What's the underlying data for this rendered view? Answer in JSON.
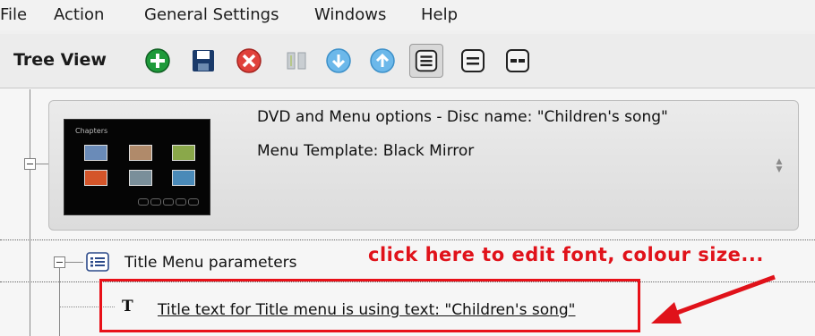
{
  "menubar": {
    "items": [
      "File",
      "Action",
      "General Settings",
      "Windows",
      "Help"
    ]
  },
  "toolbar": {
    "title": "Tree View",
    "buttons": [
      {
        "icon": "add-icon",
        "color": "#1e9a3a"
      },
      {
        "icon": "save-icon",
        "color": "#1a3a6a"
      },
      {
        "icon": "delete-icon",
        "color": "#e0413b"
      },
      {
        "icon": "split-icon",
        "color": "#9aa2a8"
      },
      {
        "icon": "move-down-icon",
        "color": "#4aa3e0"
      },
      {
        "icon": "move-up-icon",
        "color": "#4aa3e0"
      },
      {
        "icon": "view-list-icon",
        "selected": true
      },
      {
        "icon": "view-compact-icon"
      },
      {
        "icon": "view-detail-icon"
      }
    ]
  },
  "dvd": {
    "line1": "DVD and Menu options - Disc name: \"Children's song\"",
    "line2": "Menu Template: Black Mirror",
    "thumb_label": "Chapters"
  },
  "title_menu": {
    "label": "Title Menu parameters"
  },
  "annotation": {
    "text": "click here to edit font, colour size...",
    "color": "#e0121a"
  },
  "title_text": {
    "icon_glyph": "T",
    "label": "Title text for Title menu is using text: \"Children's song\""
  }
}
